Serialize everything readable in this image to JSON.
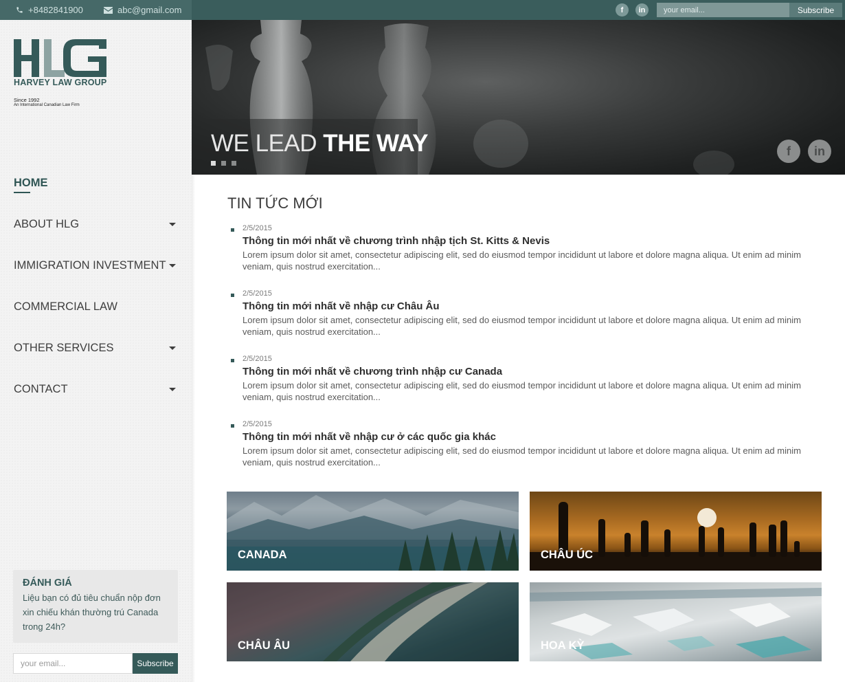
{
  "topbar": {
    "phone": "+8482841900",
    "email": "abc@gmail.com",
    "social": [
      "f",
      "in"
    ],
    "email_placeholder": "your email...",
    "subscribe_label": "Subscribe"
  },
  "logo": {
    "letters": "HLG",
    "name": "HARVEY LAW GROUP",
    "since": "Since 1992",
    "tagline": "An International Canadian Law Firm"
  },
  "nav": {
    "items": [
      {
        "label": "HOME",
        "active": true,
        "has_dropdown": false
      },
      {
        "label": "ABOUT HLG",
        "has_dropdown": true
      },
      {
        "label": "IMMIGRATION INVESTMENT",
        "has_dropdown": true
      },
      {
        "label": "COMMERCIAL LAW",
        "has_dropdown": false
      },
      {
        "label": "OTHER SERVICES",
        "has_dropdown": true
      },
      {
        "label": "CONTACT",
        "has_dropdown": true
      }
    ]
  },
  "evaluation": {
    "title": "ĐÁNH GIÁ",
    "text": "Liệu bạn có đủ tiêu chuẩn nộp đơn xin chiếu khán thường trú Canada trong 24h?"
  },
  "sidebar_subscribe": {
    "placeholder": "your email...",
    "button_label": "Subscribe"
  },
  "hero": {
    "title_thin": "WE LEAD",
    "title_bold": "THE WAY",
    "slide_count": 3,
    "active_slide": 1,
    "social": [
      "f",
      "in"
    ]
  },
  "news": {
    "heading": "TIN TỨC MỚI",
    "items": [
      {
        "date": "2/5/2015",
        "title": "Thông tin mới nhất về chương trình nhập tịch St. Kitts & Nevis",
        "excerpt": "Lorem ipsum dolor sit amet, consectetur adipiscing elit, sed do eiusmod tempor incididunt ut labore et dolore magna aliqua. Ut enim ad minim veniam, quis nostrud exercitation..."
      },
      {
        "date": "2/5/2015",
        "title": "Thông tin mới nhất về nhập cư Châu Âu",
        "excerpt": "Lorem ipsum dolor sit amet, consectetur adipiscing elit, sed do eiusmod tempor incididunt ut labore et dolore magna aliqua. Ut enim ad minim veniam, quis nostrud exercitation..."
      },
      {
        "date": "2/5/2015",
        "title": "Thông tin mới nhất về chương trình nhập cư Canada",
        "excerpt": "Lorem ipsum dolor sit amet, consectetur adipiscing elit, sed do eiusmod tempor incididunt ut labore et dolore magna aliqua. Ut enim ad minim veniam, quis nostrud exercitation..."
      },
      {
        "date": "2/5/2015",
        "title": "Thông tin mới nhất về nhập cư ở các quốc gia khác",
        "excerpt": "Lorem ipsum dolor sit amet, consectetur adipiscing elit, sed do eiusmod tempor incididunt ut labore et dolore magna aliqua. Ut enim ad minim veniam, quis nostrud exercitation..."
      }
    ]
  },
  "regions": [
    {
      "label": "CANADA"
    },
    {
      "label": "CHÂU ÚC"
    },
    {
      "label": "CHÂU ÂU"
    },
    {
      "label": "HOA KỲ"
    }
  ],
  "colors": {
    "brand": "#355a59",
    "topbar": "#3a5d5c",
    "sidebar_bg": "#f3f3f3"
  }
}
